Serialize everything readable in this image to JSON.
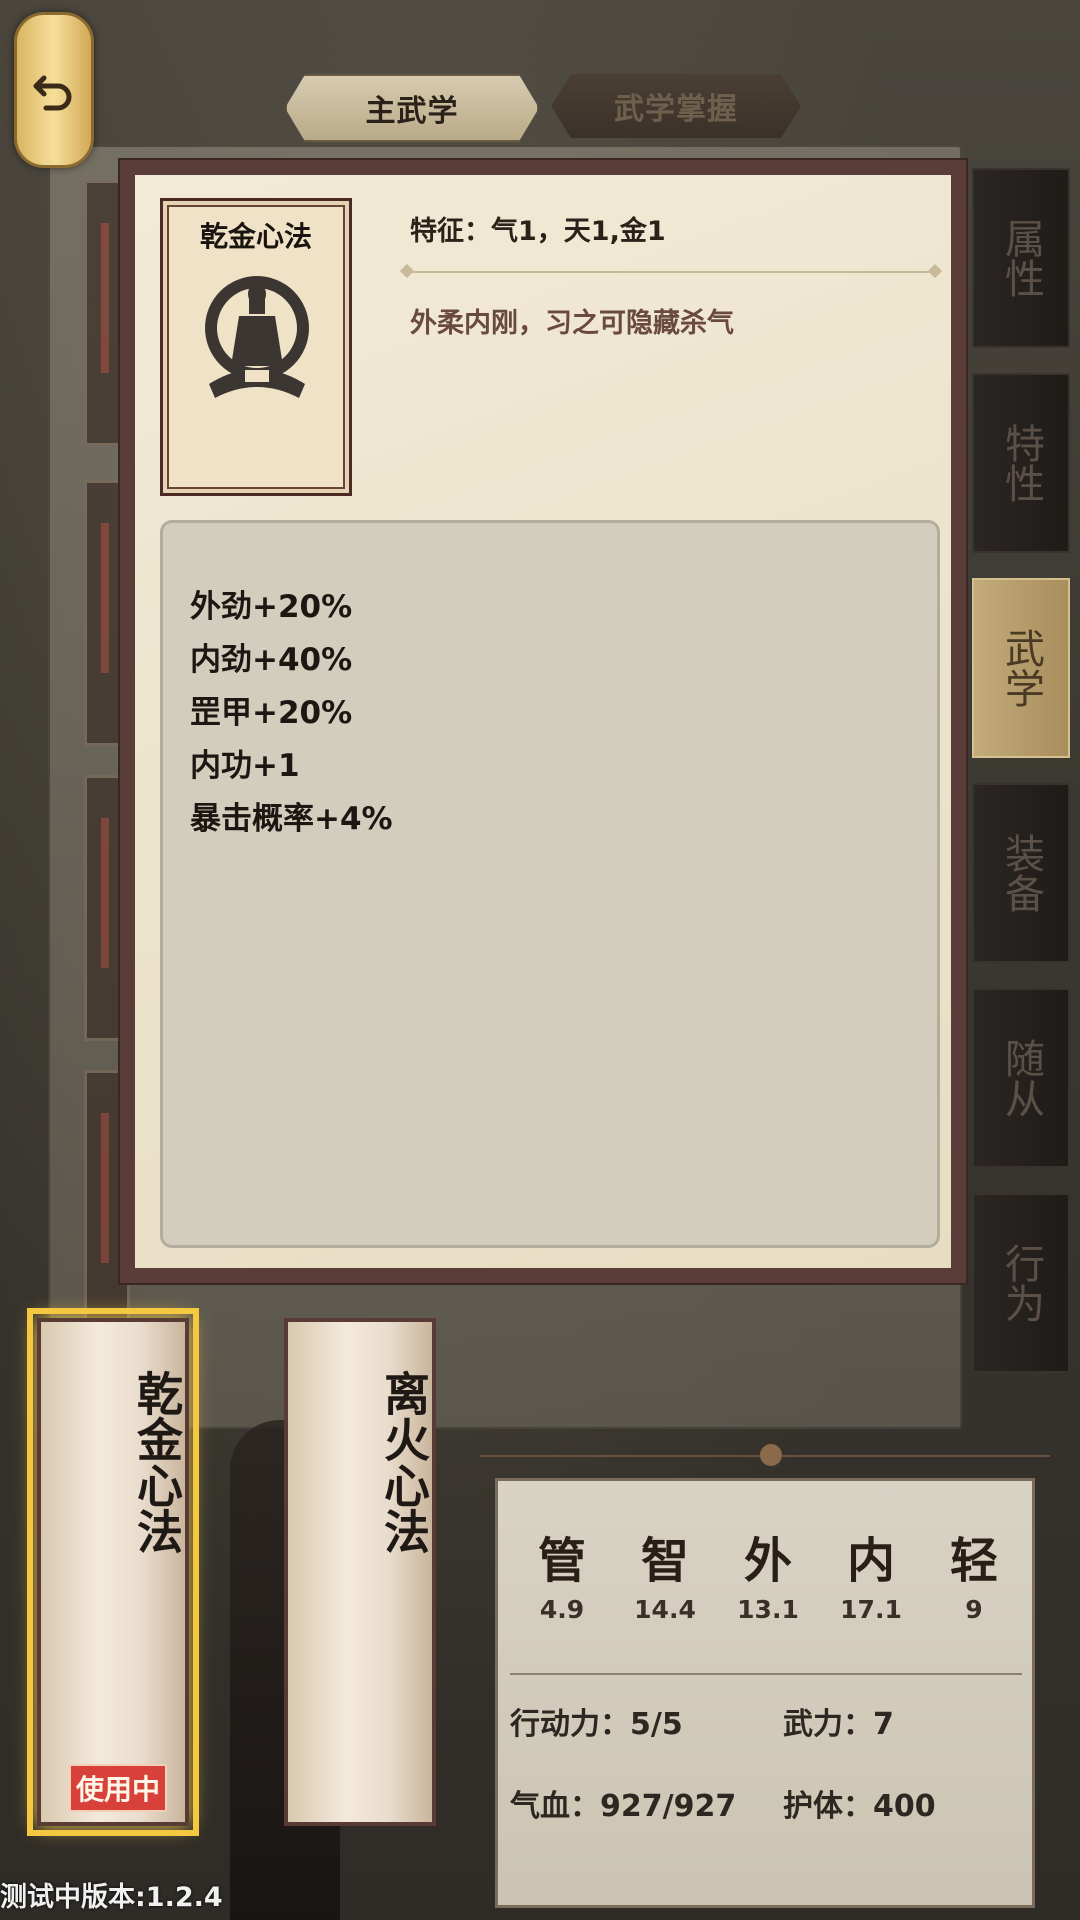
{
  "tabs": {
    "main": "主武学",
    "mastery": "武学掌握"
  },
  "side_tabs": [
    {
      "label": "属性"
    },
    {
      "label": "特性"
    },
    {
      "label": "武学"
    },
    {
      "label": "装备"
    },
    {
      "label": "随从"
    },
    {
      "label": "行为"
    }
  ],
  "detail": {
    "name": "乾金心法",
    "feature": "特征：气1，天1,金1",
    "description": "外柔内刚，习之可隐藏杀气",
    "effects": [
      "外劲+20%",
      "内劲+40%",
      "罡甲+20%",
      "内功+1",
      "暴击概率+4%"
    ]
  },
  "skills": [
    {
      "name": "乾金心法",
      "status": "使用中"
    },
    {
      "name": "离火心法"
    }
  ],
  "attributes": [
    {
      "label": "管",
      "value": "4.9"
    },
    {
      "label": "智",
      "value": "14.4"
    },
    {
      "label": "外",
      "value": "13.1"
    },
    {
      "label": "内",
      "value": "17.1"
    },
    {
      "label": "轻",
      "value": "9"
    }
  ],
  "stats": {
    "action": "行动力：5/5",
    "force": "武力：7",
    "hp": "气血：927/927",
    "shield": "护体：400"
  },
  "version": "测试中版本:1.2.4",
  "colors": {
    "active_tab": "#b9aa88",
    "in_use_badge": "#d8413a",
    "selected_glow": "#f5c842"
  }
}
